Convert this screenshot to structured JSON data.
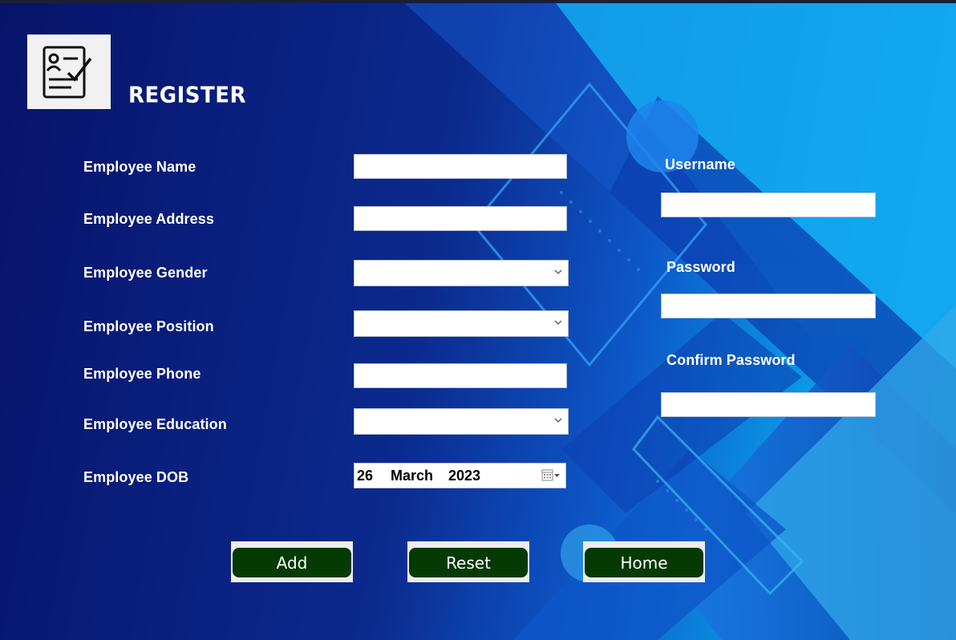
{
  "form": {
    "title": "REGISTER",
    "fields": {
      "employee_name": {
        "label": "Employee Name",
        "value": ""
      },
      "employee_address": {
        "label": "Employee Address",
        "value": ""
      },
      "employee_gender": {
        "label": "Employee Gender",
        "selected": ""
      },
      "employee_position": {
        "label": "Employee Position",
        "selected": ""
      },
      "employee_phone": {
        "label": "Employee Phone",
        "value": ""
      },
      "employee_education": {
        "label": "Employee Education",
        "selected": ""
      },
      "employee_dob": {
        "label": "Employee DOB",
        "day": "26",
        "month": "March",
        "year": "2023"
      }
    },
    "account": {
      "username": {
        "label": "Username",
        "value": ""
      },
      "password": {
        "label": "Password",
        "value": ""
      },
      "confirm_password": {
        "label": "Confirm Password",
        "value": ""
      }
    },
    "buttons": {
      "add": "Add",
      "reset": "Reset",
      "home": "Home"
    }
  },
  "icons": {
    "logo": "register-form-icon",
    "dropdown": "chevron-down-icon",
    "calendar": "calendar-icon"
  },
  "colors": {
    "button_bg": "#053a05",
    "button_frame": "#ececec",
    "text": "#ffffff"
  }
}
